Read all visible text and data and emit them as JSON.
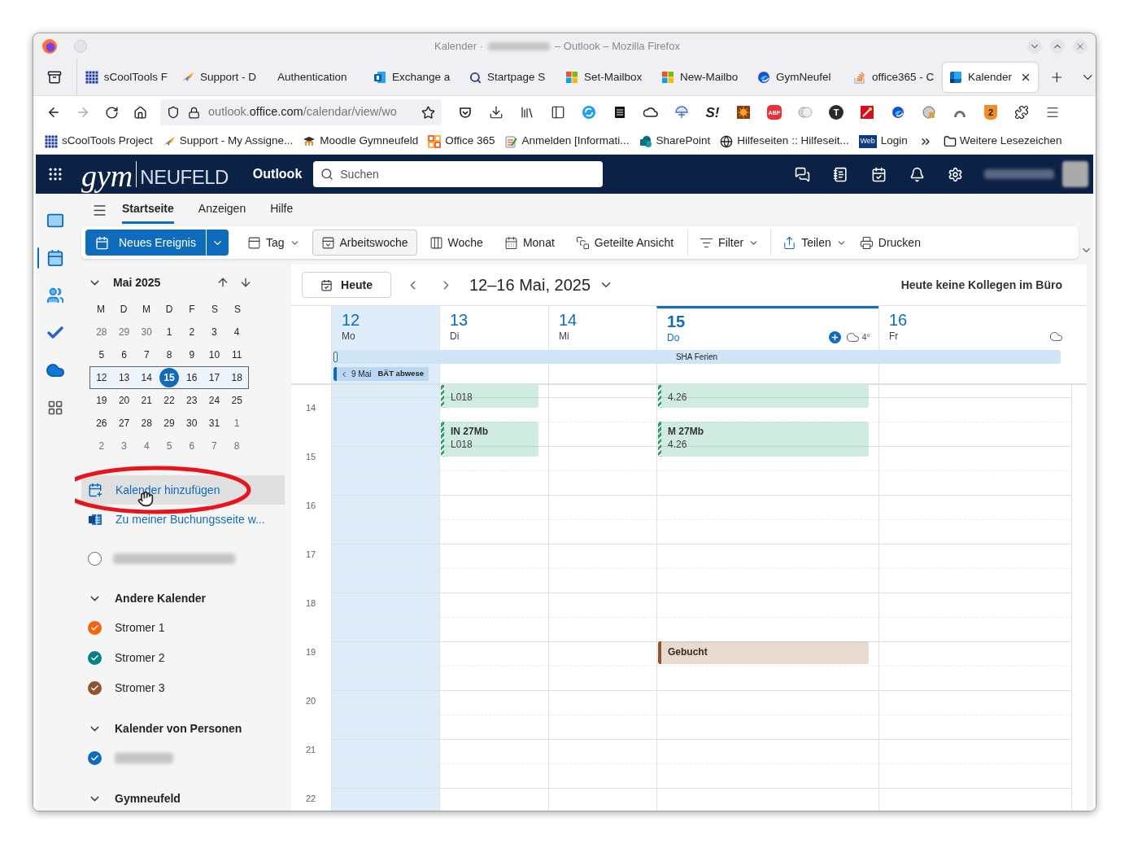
{
  "window": {
    "title_start": "Kalender ·",
    "title_end": "– Outlook – Mozilla Firefox"
  },
  "browser_tabs": [
    {
      "label": "sCoolTools F",
      "selected": false
    },
    {
      "label": "Support - D",
      "selected": false
    },
    {
      "label": "Authentication",
      "selected": false
    },
    {
      "label": "Exchange a",
      "selected": false
    },
    {
      "label": "Startpage S",
      "selected": false
    },
    {
      "label": "Set-Mailbox",
      "selected": false
    },
    {
      "label": "New-Mailbo",
      "selected": false
    },
    {
      "label": "GymNeufel",
      "selected": false
    },
    {
      "label": "office365 - C",
      "selected": false
    },
    {
      "label": "Kalender",
      "selected": true
    }
  ],
  "address_bar": {
    "url_start": "outlook.",
    "url_domain": "office.com",
    "url_end": "/calendar/view/wo"
  },
  "extension_badges": [
    "S!",
    "ABP",
    "T",
    "2"
  ],
  "bookmarks": [
    "sCoolTools Project",
    "Support - My Assigne...",
    "Moodle Gymneufeld",
    "Office 365",
    "Anmelden [Informati...",
    "SharePoint",
    "Hilfeseiten :: Hilfeseit...",
    "Login"
  ],
  "bookmark_icon_label": "Web",
  "other_bookmarks": "Weitere Lesezeichen",
  "outlook": {
    "logo_script": "gym",
    "logo_caps": "NEUFELD",
    "app_name": "Outlook",
    "search_placeholder": "Suchen"
  },
  "app_rail": [
    {
      "selected": false
    },
    {
      "selected": true
    },
    {
      "selected": false
    },
    {
      "selected": false
    },
    {
      "selected": false
    },
    {
      "selected": false
    }
  ],
  "ribbon_tabs": [
    {
      "label": "Startseite",
      "selected": true
    },
    {
      "label": "Anzeigen",
      "selected": false
    },
    {
      "label": "Hilfe",
      "selected": false
    }
  ],
  "new_event": "Neues Ereignis",
  "views": [
    {
      "label": "Tag",
      "dropdown": true,
      "selected": false
    },
    {
      "label": "Arbeitswoche",
      "dropdown": false,
      "selected": true
    },
    {
      "label": "Woche",
      "dropdown": false,
      "selected": false
    },
    {
      "label": "Monat",
      "dropdown": false,
      "selected": false
    },
    {
      "label": "Geteilte Ansicht",
      "dropdown": false,
      "selected": false
    }
  ],
  "actions": [
    {
      "label": "Filter",
      "dropdown": true
    },
    {
      "label": "Teilen",
      "dropdown": true
    },
    {
      "label": "Drucken",
      "dropdown": false
    }
  ],
  "mini_calendar": {
    "title": "Mai 2025",
    "expanded": true,
    "weekdays": [
      "M",
      "D",
      "M",
      "D",
      "F",
      "S",
      "S"
    ],
    "weeks": [
      {
        "selected": false,
        "days": [
          {
            "label": "28",
            "muted": true,
            "today": false
          },
          {
            "label": "29",
            "muted": true,
            "today": false
          },
          {
            "label": "30",
            "muted": true,
            "today": false
          },
          {
            "label": "1",
            "muted": false,
            "today": false
          },
          {
            "label": "2",
            "muted": false,
            "today": false
          },
          {
            "label": "3",
            "muted": false,
            "today": false
          },
          {
            "label": "4",
            "muted": false,
            "today": false
          }
        ]
      },
      {
        "selected": false,
        "days": [
          {
            "label": "5",
            "muted": false,
            "today": false
          },
          {
            "label": "6",
            "muted": false,
            "today": false
          },
          {
            "label": "7",
            "muted": false,
            "today": false
          },
          {
            "label": "8",
            "muted": false,
            "today": false
          },
          {
            "label": "9",
            "muted": false,
            "today": false
          },
          {
            "label": "10",
            "muted": false,
            "today": false
          },
          {
            "label": "11",
            "muted": false,
            "today": false
          }
        ]
      },
      {
        "selected": true,
        "days": [
          {
            "label": "12",
            "muted": false,
            "today": false
          },
          {
            "label": "13",
            "muted": false,
            "today": false
          },
          {
            "label": "14",
            "muted": false,
            "today": false
          },
          {
            "label": "15",
            "muted": false,
            "today": true
          },
          {
            "label": "16",
            "muted": false,
            "today": false
          },
          {
            "label": "17",
            "muted": false,
            "today": false
          },
          {
            "label": "18",
            "muted": false,
            "today": false
          }
        ]
      },
      {
        "selected": false,
        "days": [
          {
            "label": "19",
            "muted": false,
            "today": false
          },
          {
            "label": "20",
            "muted": false,
            "today": false
          },
          {
            "label": "21",
            "muted": false,
            "today": false
          },
          {
            "label": "22",
            "muted": false,
            "today": false
          },
          {
            "label": "23",
            "muted": false,
            "today": false
          },
          {
            "label": "24",
            "muted": false,
            "today": false
          },
          {
            "label": "25",
            "muted": false,
            "today": false
          }
        ]
      },
      {
        "selected": false,
        "days": [
          {
            "label": "26",
            "muted": false,
            "today": false
          },
          {
            "label": "27",
            "muted": false,
            "today": false
          },
          {
            "label": "28",
            "muted": false,
            "today": false
          },
          {
            "label": "29",
            "muted": false,
            "today": false
          },
          {
            "label": "30",
            "muted": false,
            "today": false
          },
          {
            "label": "31",
            "muted": false,
            "today": false
          },
          {
            "label": "1",
            "muted": true,
            "today": false
          }
        ]
      },
      {
        "selected": false,
        "days": [
          {
            "label": "2",
            "muted": true,
            "today": false
          },
          {
            "label": "3",
            "muted": true,
            "today": false
          },
          {
            "label": "4",
            "muted": true,
            "today": false
          },
          {
            "label": "5",
            "muted": true,
            "today": false
          },
          {
            "label": "6",
            "muted": true,
            "today": false
          },
          {
            "label": "7",
            "muted": true,
            "today": false
          },
          {
            "label": "8",
            "muted": true,
            "today": false
          }
        ]
      }
    ]
  },
  "pane_links": [
    {
      "label": "Kalender hinzufügen",
      "hovered": true,
      "circled": true
    },
    {
      "label": "Zu meiner Buchungsseite w...",
      "hovered": false,
      "circled": false
    }
  ],
  "my_calendars": [
    {
      "kind": "redacted",
      "checked": false
    }
  ],
  "calendar_groups": [
    {
      "title": "Andere Kalender",
      "expanded": true,
      "items": [
        {
          "kind": "named",
          "label": "Stromer 1",
          "color": "#f7630c",
          "checked": true
        },
        {
          "kind": "named",
          "label": "Stromer 2",
          "color": "#038387",
          "checked": true
        },
        {
          "kind": "named",
          "label": "Stromer 3",
          "color": "#8e562e",
          "checked": true
        }
      ]
    },
    {
      "title": "Kalender von Personen",
      "expanded": true,
      "items": [
        {
          "kind": "redacted",
          "color": "#0f6cbd",
          "checked": true
        }
      ]
    },
    {
      "title": "Gymneufeld",
      "expanded": true
    }
  ],
  "calendar": {
    "today_button": "Heute",
    "range": "12–16 Mai, 2025",
    "status": "Heute keine Kollegen im Büro",
    "banner": {
      "label": "SHA Ferien"
    },
    "days": [
      {
        "number": "12",
        "weekday": "Mo",
        "selected": true,
        "today": false,
        "weather_icon": false,
        "all_day": [
          {
            "continued_from": "9 Mai",
            "label": "BÄT abwese"
          }
        ]
      },
      {
        "number": "13",
        "weekday": "Di",
        "selected": false,
        "today": false,
        "weather_icon": false,
        "events": [
          {
            "location": "L018",
            "color": "#27a56d",
            "tentative": true
          },
          {
            "title": "IN 27Mb",
            "location": "L018",
            "color": "#27a56d",
            "tentative": true
          }
        ]
      },
      {
        "number": "14",
        "weekday": "Mi",
        "selected": false,
        "today": false,
        "weather_icon": false
      },
      {
        "number": "15",
        "weekday": "Do",
        "selected": false,
        "today": true,
        "weather_icon": true,
        "temperature": "4°",
        "events": [
          {
            "location": "4.26",
            "color": "#27a56d",
            "tentative": true
          },
          {
            "title": "M 27Mb",
            "location": "4.26",
            "color": "#27a56d",
            "tentative": true
          },
          {
            "title": "Gebucht",
            "color": "#8e562e",
            "tentative": false
          }
        ]
      },
      {
        "number": "16",
        "weekday": "Fr",
        "selected": false,
        "today": false,
        "weather_icon": true
      }
    ],
    "hours": [
      "14",
      "15",
      "16",
      "17",
      "18",
      "19",
      "20",
      "21",
      "22"
    ]
  }
}
